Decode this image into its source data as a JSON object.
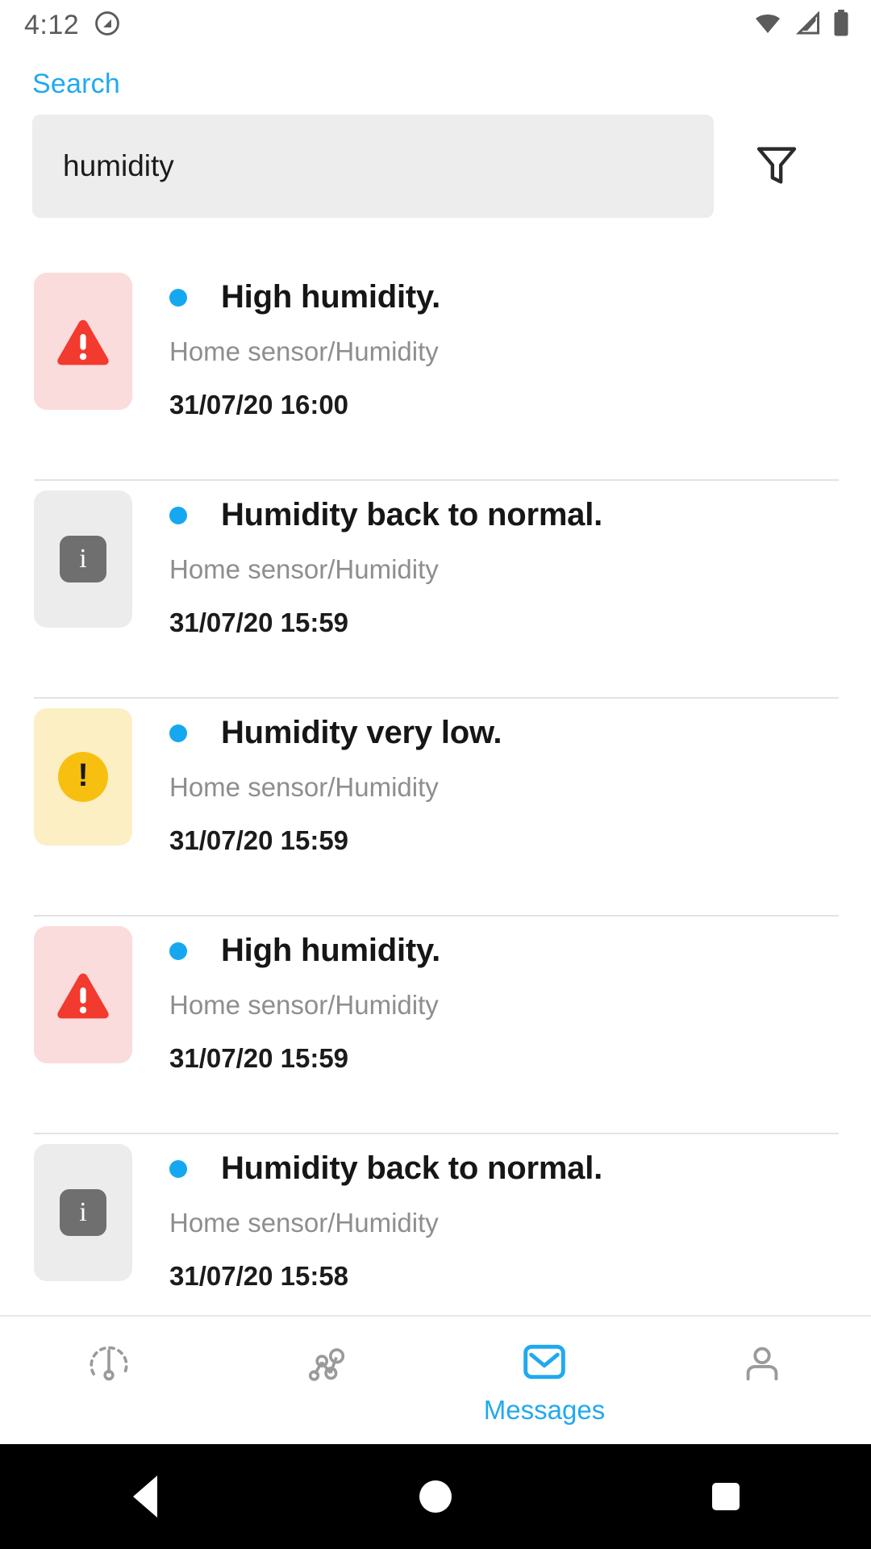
{
  "status_bar": {
    "time": "4:12",
    "left_icons": [
      "do-not-disturb-icon"
    ],
    "right_icons": [
      "wifi-icon",
      "cellular-signal-icon",
      "battery-icon"
    ]
  },
  "header": {
    "screen_label": "Search",
    "accent_color": "#21A9F0"
  },
  "search": {
    "value": "humidity",
    "placeholder": "Search",
    "filter_icon": "filter-funnel-icon"
  },
  "messages": [
    {
      "severity": "alert",
      "icon": "warning-triangle-icon",
      "unread": true,
      "title": "High humidity.",
      "source": "Home sensor/Humidity",
      "timestamp": "31/07/20 16:00"
    },
    {
      "severity": "info",
      "icon": "info-icon",
      "unread": true,
      "title": "Humidity back to normal.",
      "source": "Home sensor/Humidity",
      "timestamp": "31/07/20 15:59"
    },
    {
      "severity": "warn",
      "icon": "exclamation-circle-icon",
      "unread": true,
      "title": "Humidity very low.",
      "source": "Home sensor/Humidity",
      "timestamp": "31/07/20 15:59"
    },
    {
      "severity": "alert",
      "icon": "warning-triangle-icon",
      "unread": true,
      "title": "High humidity.",
      "source": "Home sensor/Humidity",
      "timestamp": "31/07/20 15:59"
    },
    {
      "severity": "info",
      "icon": "info-icon",
      "unread": true,
      "title": "Humidity back to normal.",
      "source": "Home sensor/Humidity",
      "timestamp": "31/07/20 15:58"
    }
  ],
  "tab_bar": {
    "active": "messages",
    "tabs": [
      {
        "key": "dashboard",
        "icon": "gauge-icon",
        "label": ""
      },
      {
        "key": "devices",
        "icon": "network-nodes-icon",
        "label": ""
      },
      {
        "key": "messages",
        "icon": "envelope-icon",
        "label": "Messages"
      },
      {
        "key": "profile",
        "icon": "person-icon",
        "label": ""
      }
    ]
  },
  "system_nav": {
    "back": "back-triangle-icon",
    "home": "home-circle-icon",
    "recents": "recents-square-icon"
  },
  "colors": {
    "accent": "#21A9F0",
    "unread_dot": "#15A8F0",
    "alert_bg": "#FBDCDC",
    "alert_fg": "#F23A2E",
    "info_bg": "#ECECEC",
    "info_fg": "#6F6F6F",
    "warn_bg": "#FCEFC4",
    "warn_fg": "#F7C010"
  }
}
